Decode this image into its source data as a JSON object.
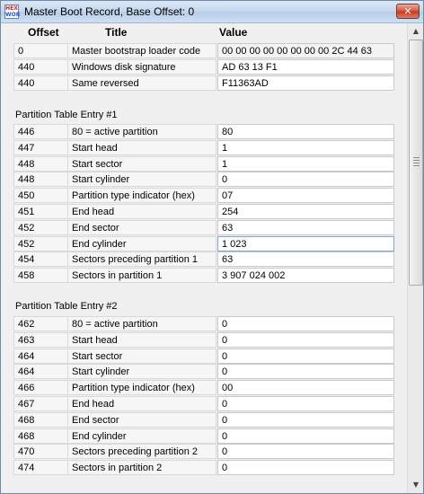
{
  "window": {
    "title": "Master Boot Record, Base Offset: 0",
    "icon_text_top": "HEX",
    "icon_text_bottom": "WOR",
    "close_glyph": "✕"
  },
  "columns": {
    "offset": "Offset",
    "title": "Title",
    "value": "Value"
  },
  "mbr_rows": [
    {
      "offset": "0",
      "title": "Master bootstrap loader code",
      "value": "00 00 00 00 00 00 00 00 2C 44 63"
    },
    {
      "offset": "440",
      "title": "Windows disk signature",
      "value": "AD 63 13 F1"
    },
    {
      "offset": "440",
      "title": "Same reversed",
      "value": "F11363AD"
    }
  ],
  "partition1": {
    "label": "Partition Table Entry #1",
    "rows": [
      {
        "offset": "446",
        "title": "80 = active partition",
        "value": "80"
      },
      {
        "offset": "447",
        "title": "Start head",
        "value": "1"
      },
      {
        "offset": "448",
        "title": "Start sector",
        "value": "1"
      },
      {
        "offset": "448",
        "title": "Start cylinder",
        "value": "0"
      },
      {
        "offset": "450",
        "title": "Partition type indicator (hex)",
        "value": "07"
      },
      {
        "offset": "451",
        "title": "End head",
        "value": "254"
      },
      {
        "offset": "452",
        "title": "End sector",
        "value": "63"
      },
      {
        "offset": "452",
        "title": "End cylinder",
        "value": "1 023"
      },
      {
        "offset": "454",
        "title": "Sectors preceding partition 1",
        "value": "63"
      },
      {
        "offset": "458",
        "title": "Sectors in partition 1",
        "value": "3 907 024 002"
      }
    ]
  },
  "partition2": {
    "label": "Partition Table Entry #2",
    "rows": [
      {
        "offset": "462",
        "title": "80 = active partition",
        "value": "0"
      },
      {
        "offset": "463",
        "title": "Start head",
        "value": "0"
      },
      {
        "offset": "464",
        "title": "Start sector",
        "value": "0"
      },
      {
        "offset": "464",
        "title": "Start cylinder",
        "value": "0"
      },
      {
        "offset": "466",
        "title": "Partition type indicator (hex)",
        "value": "00"
      },
      {
        "offset": "467",
        "title": "End head",
        "value": "0"
      },
      {
        "offset": "468",
        "title": "End sector",
        "value": "0"
      },
      {
        "offset": "468",
        "title": "End cylinder",
        "value": "0"
      },
      {
        "offset": "470",
        "title": "Sectors preceding partition 2",
        "value": "0"
      },
      {
        "offset": "474",
        "title": "Sectors in partition 2",
        "value": "0"
      }
    ]
  },
  "scrollbar": {
    "up_glyph": "▲",
    "down_glyph": "▼",
    "icon": "scroll-grip"
  }
}
